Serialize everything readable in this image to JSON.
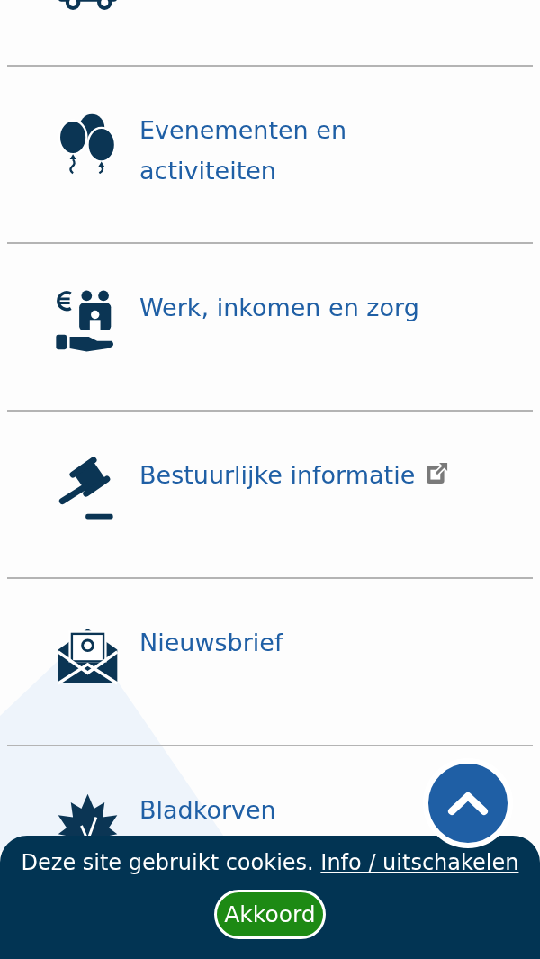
{
  "menu": {
    "items": [
      {
        "kind": "truck"
      },
      {
        "kind": "balloons",
        "label": "Evenementen en activiteiten",
        "external": false
      },
      {
        "kind": "care",
        "label": "Werk, inkomen en zorg",
        "external": false
      },
      {
        "kind": "gavel",
        "label": "Bestuurlijke informatie",
        "external": true
      },
      {
        "kind": "envelope",
        "label": "Nieuwsbrief",
        "external": false
      },
      {
        "kind": "leaf",
        "label": "Bladkorven",
        "external": false
      }
    ]
  },
  "cookie_bar": {
    "text": "Deze site gebruikt cookies.",
    "link": "Info / uitschakelen",
    "button": "Akkoord"
  }
}
